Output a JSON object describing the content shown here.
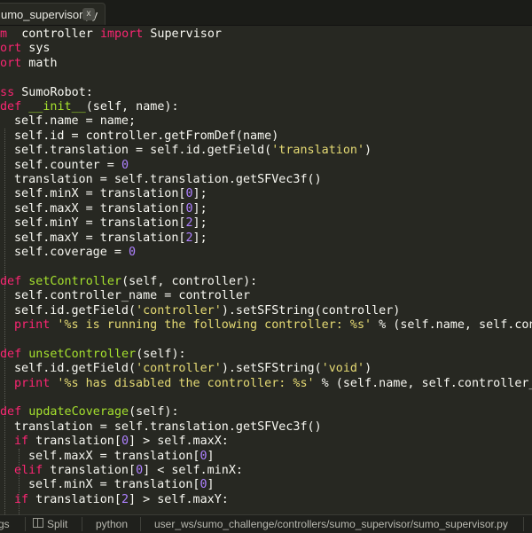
{
  "tab": {
    "label": "umo_supervisor.py",
    "close": "x"
  },
  "status": {
    "left": "gs",
    "split_icon": "columns-icon",
    "split": "Split",
    "language": "python",
    "path": "user_ws/sumo_challenge/controllers/sumo_supervisor/sumo_supervisor.py"
  },
  "code": [
    [
      "om ",
      " controller ",
      "import",
      " Supervisor"
    ],
    [
      "port",
      " sys"
    ],
    [
      "port",
      " math"
    ],
    [],
    [
      "ass",
      " SumoRobot:"
    ],
    [
      "def",
      " __init__",
      "(self, name):"
    ],
    [
      "self.name = name;"
    ],
    [
      "self.id = controller.getFromDef(name)"
    ],
    [
      "self.translation = self.id.getField(",
      "'translation'",
      ")"
    ],
    [
      "self.counter = ",
      "0"
    ],
    [
      "translation = self.translation.getSFVec3f()"
    ],
    [
      "self.minX = translation[",
      "0",
      "];"
    ],
    [
      "self.maxX = translation[",
      "0",
      "];"
    ],
    [
      "self.minY = translation[",
      "2",
      "];"
    ],
    [
      "self.maxY = translation[",
      "2",
      "];"
    ],
    [
      "self.coverage = ",
      "0"
    ],
    [],
    [
      "def",
      " setController",
      "(self, controller):"
    ],
    [
      "self.controller_name = controller"
    ],
    [
      "self.id.getField(",
      "'controller'",
      ").setSFString(controller)"
    ],
    [
      "print",
      " ",
      "'%s is running the following controller: %s'",
      " % (self.name, self.controlle"
    ],
    [],
    [
      "def",
      " unsetController",
      "(self):"
    ],
    [
      "self.id.getField(",
      "'controller'",
      ").setSFString(",
      "'void'",
      ")"
    ],
    [
      "print",
      " ",
      "'%s has disabled the controller: %s'",
      " % (self.name, self.controller_name)"
    ],
    [],
    [
      "def",
      " updateCoverage",
      "(self):"
    ],
    [
      "translation = self.translation.getSFVec3f()"
    ],
    [
      "if",
      " translation[",
      "0",
      "] > self.maxX:"
    ],
    [
      "self.maxX = translation[",
      "0",
      "]"
    ],
    [
      "elif",
      " translation[",
      "0",
      "] < self.minX:"
    ],
    [
      "self.minX = translation[",
      "0",
      "]"
    ],
    [
      "if",
      " translation[",
      "2",
      "] > self.maxY:"
    ]
  ]
}
